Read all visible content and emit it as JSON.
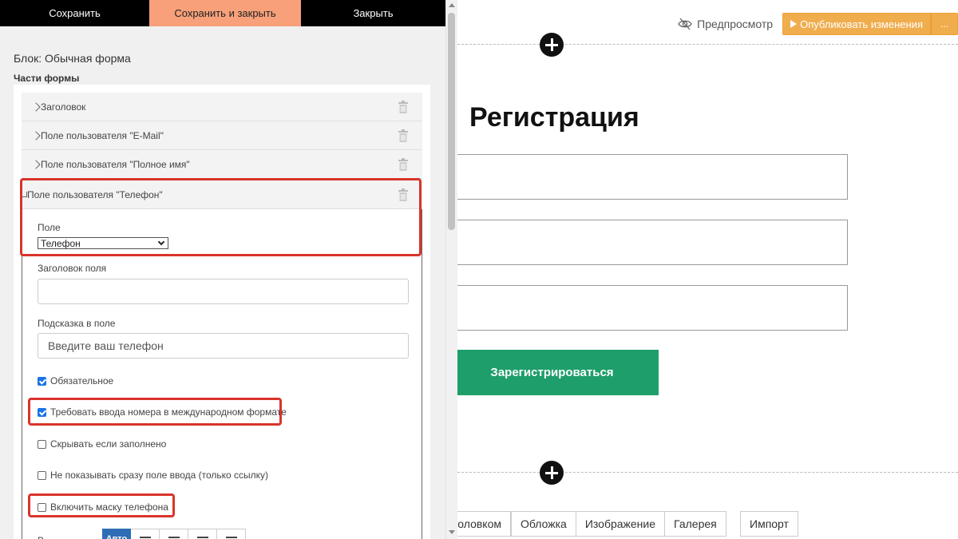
{
  "toolbar": {
    "save": "Сохранить",
    "save_close": "Сохранить и закрыть",
    "close": "Закрыть"
  },
  "editor": {
    "block_label": "Блок: Обычная форма",
    "parts_label": "Части формы",
    "parts": [
      {
        "label": "Заголовок"
      },
      {
        "label": "Поле пользователя \"E-Mail\""
      },
      {
        "label": "Поле пользователя \"Полное имя\""
      },
      {
        "label": "Поле пользователя \"Телефон\""
      }
    ],
    "field_label": "Поле",
    "field_select_value": "Телефон",
    "field_title_label": "Заголовок поля",
    "field_title_value": "",
    "hint_label": "Подсказка в поле",
    "hint_value": "Введите ваш телефон",
    "checkboxes": [
      {
        "label": "Обязательное",
        "checked": true
      },
      {
        "label": "Требовать ввода номера в международном формате",
        "checked": true
      },
      {
        "label": "Скрывать если заполнено",
        "checked": false
      },
      {
        "label": "Не показывать сразу поле ввода (только ссылку)",
        "checked": false
      },
      {
        "label": "Включить маску телефона",
        "checked": false
      }
    ],
    "align_label": "В",
    "align_active": "Авто"
  },
  "preview": {
    "preview_link": "Предпросмотр",
    "publish": "Опубликовать изменения",
    "publish_more": "...",
    "form_title": "Регистрация",
    "submit": "Зарегистрироваться",
    "block_tabs": [
      "головком",
      "Обложка",
      "Изображение",
      "Галерея"
    ],
    "import": "Импорт"
  },
  "colors": {
    "accent_orange": "#f0ad4e",
    "save_close_bg": "#f7a07a",
    "submit_green": "#1e9e6a",
    "highlight_red": "#d9342b",
    "checkbox_blue": "#1a73e8"
  }
}
